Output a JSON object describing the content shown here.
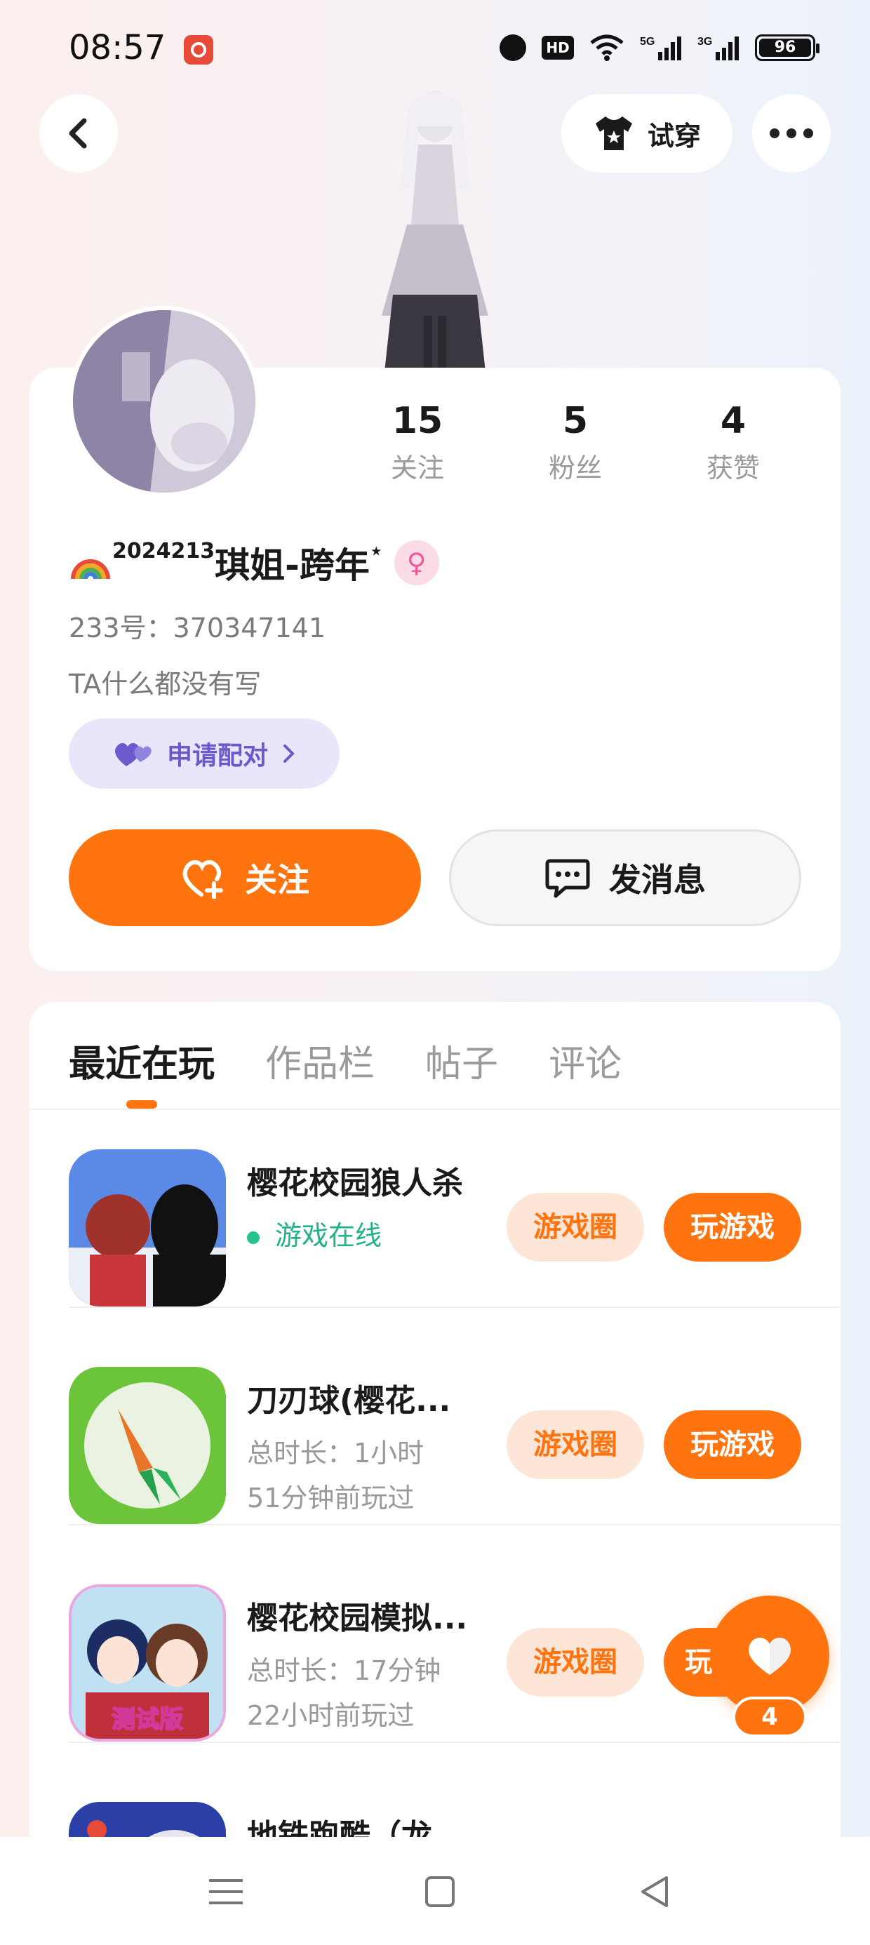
{
  "status_bar": {
    "time": "08:57",
    "hd_label": "HD",
    "battery": "96",
    "net_5g": "5G",
    "net_3g": "3G"
  },
  "header": {
    "try_on_label": "试穿"
  },
  "profile": {
    "stats": [
      {
        "value": "15",
        "label": "关注"
      },
      {
        "value": "5",
        "label": "粉丝"
      },
      {
        "value": "4",
        "label": "获赞"
      }
    ],
    "nickname_prefix": "2024213",
    "nickname": "琪姐-跨年",
    "nickname_suffix": "⋆",
    "gender_symbol": "♀",
    "uid": "233号：370347141",
    "bio": "TA什么都没有写",
    "pair_label": "申请配对",
    "follow_label": "关注",
    "message_label": "发消息"
  },
  "tabs": [
    {
      "label": "最近在玩",
      "active": true
    },
    {
      "label": "作品栏",
      "active": false
    },
    {
      "label": "帖子",
      "active": false
    },
    {
      "label": "评论",
      "active": false
    }
  ],
  "games": [
    {
      "name": "樱花校园狼人杀",
      "status": "游戏在线",
      "circle_label": "游戏圈",
      "play_label": "玩游戏"
    },
    {
      "name": "刀刃球(樱花...",
      "duration": "总时长：1小时",
      "last_played": "51分钟前玩过",
      "circle_label": "游戏圈",
      "play_label": "玩游戏"
    },
    {
      "name": "樱花校园模拟...",
      "duration": "总时长：17分钟",
      "last_played": "22小时前玩过",
      "circle_label": "游戏圈",
      "play_label": "玩"
    },
    {
      "name": "地铁跑酷（龙"
    }
  ],
  "test_badge": "测试版",
  "like_count": "4",
  "colors": {
    "accent": "#ff740f",
    "online": "#22c38e",
    "pair": "#6a5acd"
  }
}
